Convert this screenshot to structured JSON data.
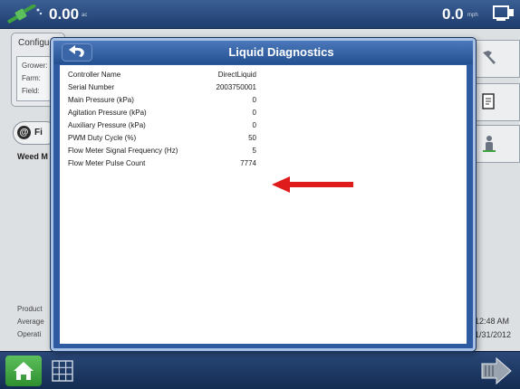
{
  "status_bar": {
    "speed_left": "0.00",
    "speed_left_unit": "ac",
    "speed_right": "0.0",
    "speed_right_unit": "mph"
  },
  "background": {
    "config_title": "Configu",
    "config_fields": [
      "Grower:",
      "Farm:",
      "Field:"
    ],
    "field_button_label": "Fi",
    "weed_label": "Weed M",
    "bottom_labels": [
      "Product",
      "Average",
      "Operati"
    ],
    "time": "12:48 AM",
    "date": "1/31/2012"
  },
  "dialog": {
    "title": "Liquid Diagnostics",
    "rows": [
      {
        "label": "Controller Name",
        "value": "DirectLiquid"
      },
      {
        "label": "Serial Number",
        "value": "2003750001"
      },
      {
        "label": "Main Pressure (kPa)",
        "value": "0"
      },
      {
        "label": "Agitation Pressure (kPa)",
        "value": "0"
      },
      {
        "label": "Auxiliary Pressure (kPa)",
        "value": "0"
      },
      {
        "label": "PWM Duty Cycle (%)",
        "value": "50"
      },
      {
        "label": "Flow Meter Signal Frequency (Hz)",
        "value": "5"
      },
      {
        "label": "Flow Meter Pulse Count",
        "value": "7774"
      }
    ]
  },
  "icons": {
    "gps": "gps-signal-icon",
    "screen": "display-icon",
    "back": "back-arrow-icon",
    "wrench": "wrench-icon",
    "document": "document-icon",
    "operator": "operator-icon",
    "home": "home-icon",
    "grid": "grid-icon",
    "field_arrow": "field-arrow-icon",
    "annotation": "red-arrow-annotation"
  },
  "colors": {
    "dialog_frame": "#2e5aa1",
    "annotation_arrow": "#e01b1b",
    "home_button": "#3fa33f"
  }
}
